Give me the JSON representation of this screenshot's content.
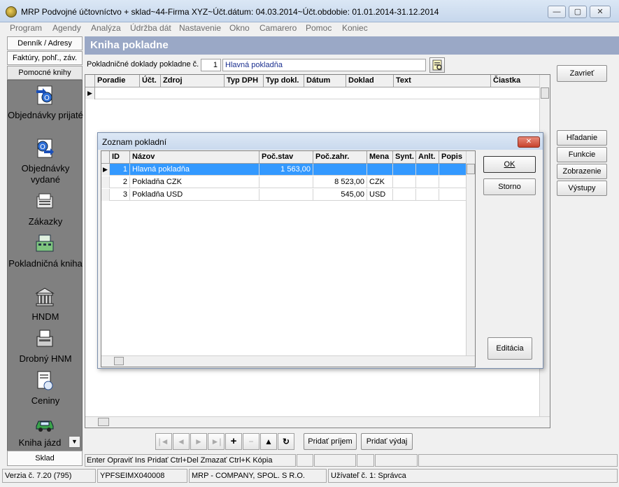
{
  "window": {
    "title": "MRP Podvojné účtovníctvo + sklad~44-Firma XYZ~Účt.dátum: 04.03.2014~Účt.obdobie: 01.01.2014-31.12.2014",
    "minimize": "—",
    "maximize": "▢",
    "close": "✕"
  },
  "menu": [
    "Program",
    "Agendy",
    "Analýza",
    "Údržba dát",
    "Nastavenie",
    "Okno",
    "Camarero",
    "Pomoc",
    "Koniec"
  ],
  "leftnav": {
    "tabs": [
      "Denník / Adresy",
      "Faktúry, pohľ., záv.",
      "Pomocné knihy"
    ],
    "items": [
      {
        "label": "Objednávky prijaté",
        "icon": "order-received-icon"
      },
      {
        "label": "Objednávky vydané",
        "icon": "order-issued-icon"
      },
      {
        "label": "Zákazky",
        "icon": "contracts-icon"
      },
      {
        "label": "Pokladničná kniha",
        "icon": "cash-register-icon"
      },
      {
        "label": "HNDM",
        "icon": "building-icon"
      },
      {
        "label": "Drobný HNM",
        "icon": "small-assets-icon"
      },
      {
        "label": "Ceniny",
        "icon": "valuables-icon"
      },
      {
        "label": "Kniha jázd",
        "icon": "car-icon"
      }
    ],
    "bottom_tab": "Sklad",
    "scroll_down": "▼"
  },
  "main": {
    "title": "Kniha pokladne",
    "filter_label": "Pokladničné doklady pokladne č.",
    "register_no": "1",
    "register_name": "Hlavná pokladňa",
    "columns": [
      "Poradie",
      "Účt.",
      "Zdroj",
      "Typ DPH",
      "Typ dokl.",
      "Dátum",
      "Doklad",
      "Text",
      "Čiastka"
    ],
    "side_buttons": {
      "close": "Zavrieť",
      "search": "Hľadanie",
      "functions": "Funkcie",
      "view": "Zobrazenie",
      "outputs": "Výstupy"
    }
  },
  "dialog": {
    "title": "Zoznam pokladní",
    "columns": [
      "ID",
      "Názov",
      "Poč.stav",
      "Poč.zahr.",
      "Mena",
      "Synt.",
      "Anlt.",
      "Popis"
    ],
    "rows": [
      {
        "id": "1",
        "name": "Hlavná pokladňa",
        "start": "1 563,00",
        "start_foreign": "",
        "currency": ""
      },
      {
        "id": "2",
        "name": "Pokladňa CZK",
        "start": "",
        "start_foreign": "8 523,00",
        "currency": "CZK"
      },
      {
        "id": "3",
        "name": "Pokladňa USD",
        "start": "",
        "start_foreign": "545,00",
        "currency": "USD"
      }
    ],
    "ok": "OK",
    "cancel": "Storno",
    "edit": "Editácia"
  },
  "toolbar": {
    "first": "|◄",
    "prev": "◄",
    "next": "►",
    "last": "►|",
    "add": "+",
    "remove": "−",
    "up": "▲",
    "refresh": "↻",
    "add_income": "Pridať príjem",
    "add_expense": "Pridať výdaj"
  },
  "statusbar": {
    "hint": "Enter Opraviť  Ins Pridať  Ctrl+Del Zmazať  Ctrl+K Kópia"
  },
  "footer": {
    "version": "Verzia č. 7.20 (795)",
    "serial": "YPFSEIMX040008",
    "company": "MRP - COMPANY, SPOL. S R.O.",
    "user": "Užívateľ č. 1: Správca"
  }
}
